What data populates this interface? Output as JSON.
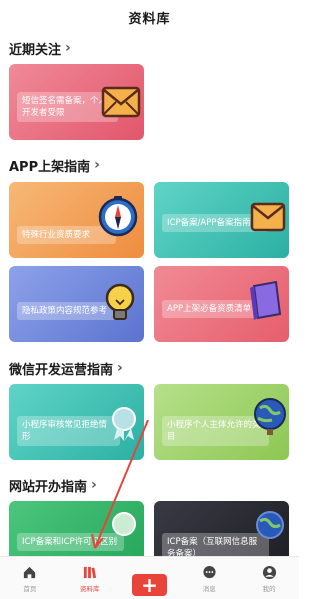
{
  "header": {
    "title": "资料库"
  },
  "sections": {
    "recent": {
      "label": "近期关注",
      "chevron": "›"
    },
    "app": {
      "label": "APP上架指南",
      "chevron": "›"
    },
    "wechat": {
      "label": "微信开发运营指南",
      "chevron": "›"
    },
    "website": {
      "label": "网站开办指南",
      "chevron": "›"
    }
  },
  "cards": {
    "sms": {
      "text": "短信签名需备案，个人开发者受限"
    },
    "special": {
      "text": "特殊行业资质要求"
    },
    "icp_app": {
      "text": "ICP备案/APP备案指南"
    },
    "privacy": {
      "text": "隐私政策内容规范参考"
    },
    "app_docs": {
      "text": "APP上架必备资质清单"
    },
    "miniprog_review": {
      "text": "小程序审核常见拒绝情形"
    },
    "miniprog_personal": {
      "text": "小程序个人主体允许的类目"
    },
    "icp_cert": {
      "text": "ICP备案和ICP许可证区别"
    },
    "icp_internet": {
      "text": "ICP备案（互联网信息服务备案）"
    }
  },
  "tabbar": {
    "home": "首页",
    "library": "资料库",
    "plus": "+",
    "messages": "消息",
    "mine": "我的"
  },
  "colors": {
    "accent": "#e8443a",
    "pink": "#ec6f80",
    "orange": "#f3a25a",
    "teal": "#3fc2b4",
    "blue": "#6f86d8",
    "lime": "#a3d36a",
    "green": "#33b86b",
    "dark": "#2b2b33"
  },
  "icons": [
    "envelope-icon",
    "compass-icon",
    "lightbulb-icon",
    "book-icon",
    "award-icon",
    "globe-icon",
    "home-icon",
    "library-icon",
    "chat-icon",
    "user-icon"
  ]
}
